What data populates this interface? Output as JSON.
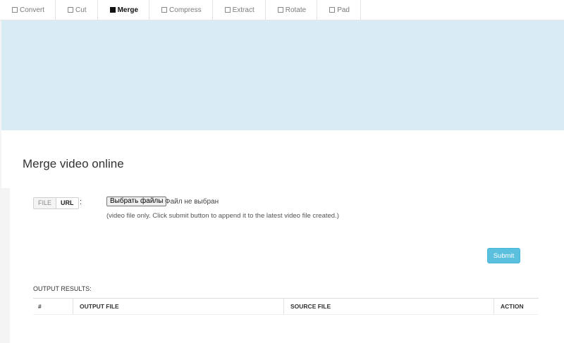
{
  "tabs": [
    {
      "label": "Convert",
      "active": false
    },
    {
      "label": "Cut",
      "active": false
    },
    {
      "label": "Merge",
      "active": true
    },
    {
      "label": "Compress",
      "active": false
    },
    {
      "label": "Extract",
      "active": false
    },
    {
      "label": "Rotate",
      "active": false
    },
    {
      "label": "Pad",
      "active": false
    }
  ],
  "main": {
    "title": "Merge video online",
    "source_toggle": {
      "file_label": "FILE",
      "url_label": "URL",
      "colon": ":"
    },
    "file_input": {
      "button_label": "Выбрать файлы",
      "status": "Файл не выбран"
    },
    "hint": "(video file only. Click submit button to append it to the latest video file created.)",
    "submit_label": "Submit",
    "results_label": "OUTPUT RESULTS:",
    "table_headers": [
      "#",
      "OUTPUT FILE",
      "SOURCE FILE",
      "ACTION"
    ]
  },
  "colors": {
    "banner": "#d9ebf5",
    "submit": "#5bc0de"
  }
}
